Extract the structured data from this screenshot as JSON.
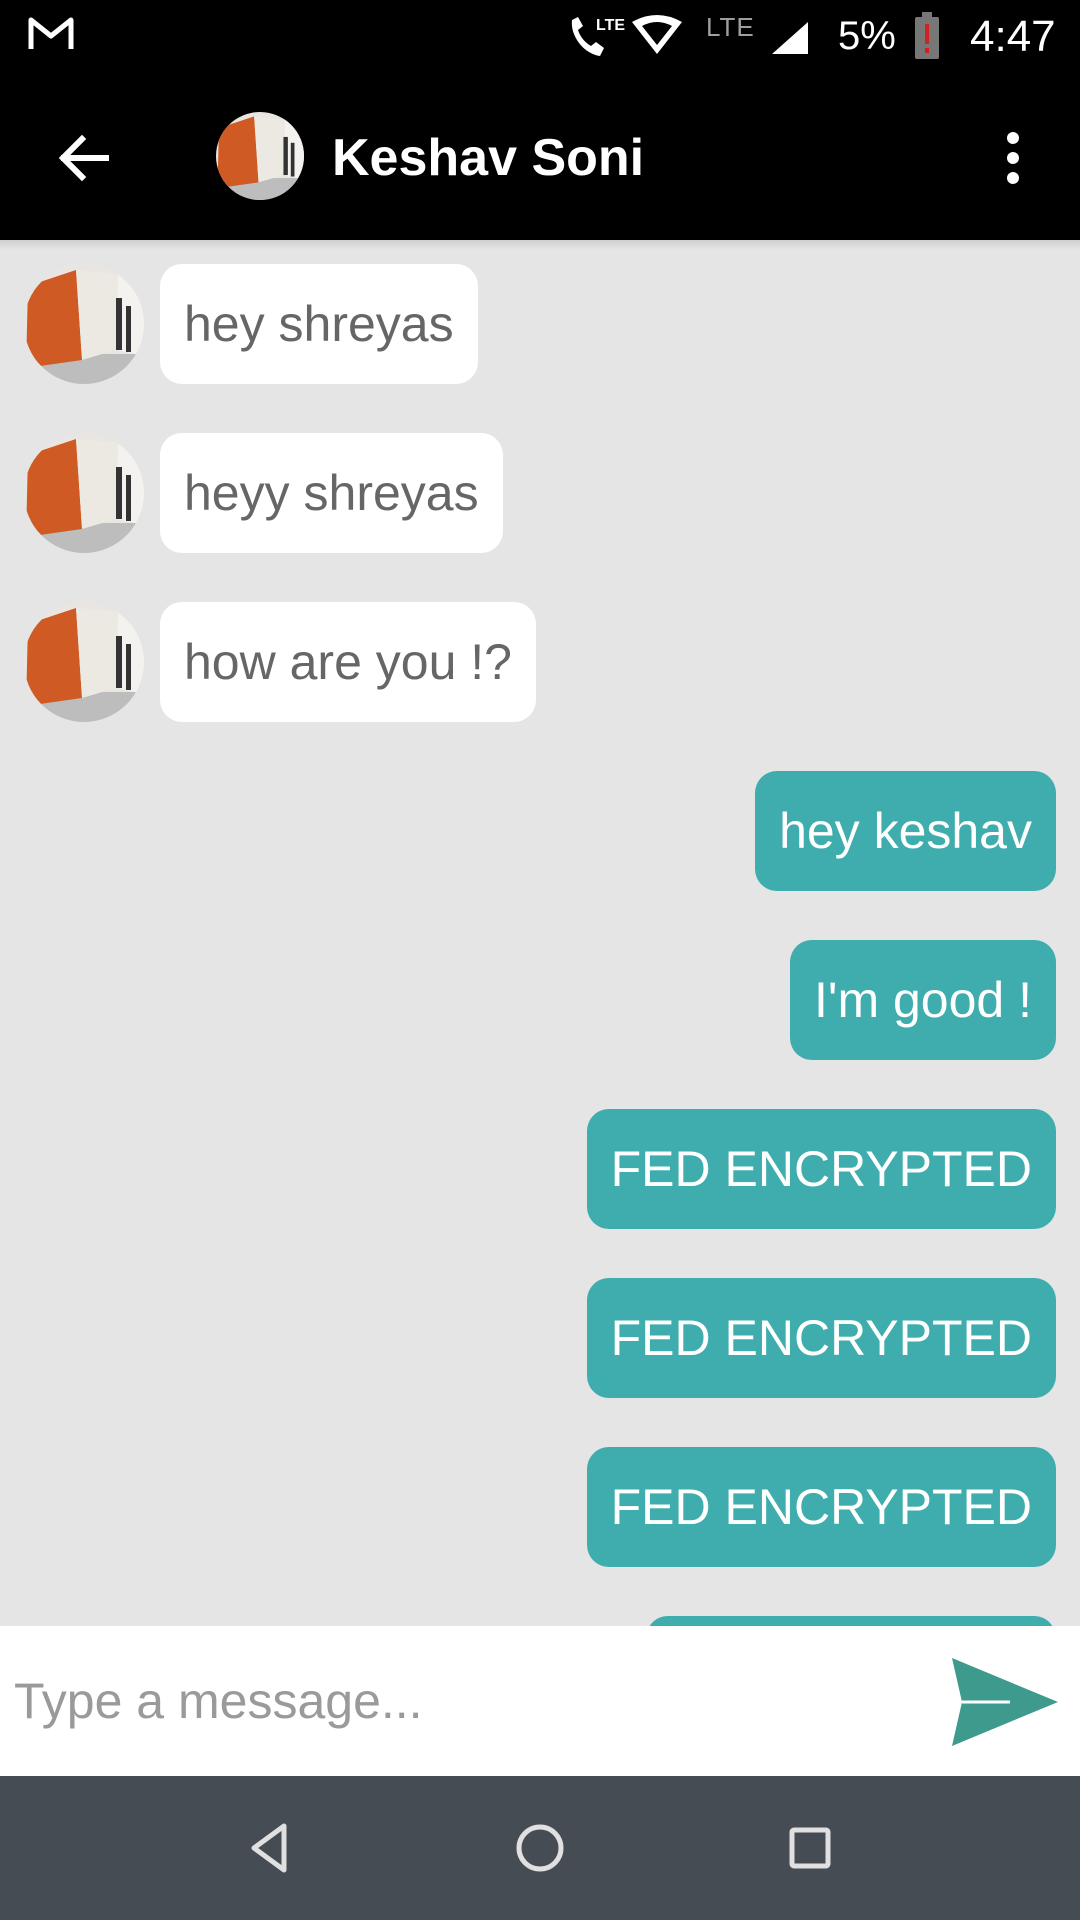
{
  "status_bar": {
    "network_label": "LTE",
    "secondary_network_label": "LTE",
    "battery_percent": "5%",
    "battery_level": 0.05,
    "time": "4:47",
    "icons": [
      "gmail-icon",
      "lte-call-icon",
      "wifi-icon",
      "signal-icon",
      "battery-alert-icon"
    ]
  },
  "app_bar": {
    "contact_name": "Keshav Soni",
    "icons": [
      "back-arrow-icon",
      "contact-avatar",
      "more-vert-icon"
    ]
  },
  "messages": [
    {
      "direction": "incoming",
      "text": "hey shreyas"
    },
    {
      "direction": "incoming",
      "text": "heyy shreyas"
    },
    {
      "direction": "incoming",
      "text": "how are you !?"
    },
    {
      "direction": "outgoing",
      "text": "hey keshav"
    },
    {
      "direction": "outgoing",
      "text": "I'm good !"
    },
    {
      "direction": "outgoing",
      "text": "FED ENCRYPTED"
    },
    {
      "direction": "outgoing",
      "text": "FED ENCRYPTED"
    },
    {
      "direction": "outgoing",
      "text": "FED ENCRYPTED"
    }
  ],
  "composer": {
    "placeholder": "Type a message...",
    "value": "",
    "send_icon": "send-icon"
  },
  "nav_bar": {
    "icons": [
      "back-triangle-icon",
      "home-circle-icon",
      "recents-square-icon"
    ]
  },
  "colors": {
    "bar_background": "#000000",
    "chat_background": "#e5e5e5",
    "incoming_bubble": "#ffffff",
    "incoming_text": "#666666",
    "outgoing_bubble": "#3fadad",
    "outgoing_text": "#ffffff",
    "send_icon": "#3e9a8c",
    "nav_background": "#464c53"
  }
}
